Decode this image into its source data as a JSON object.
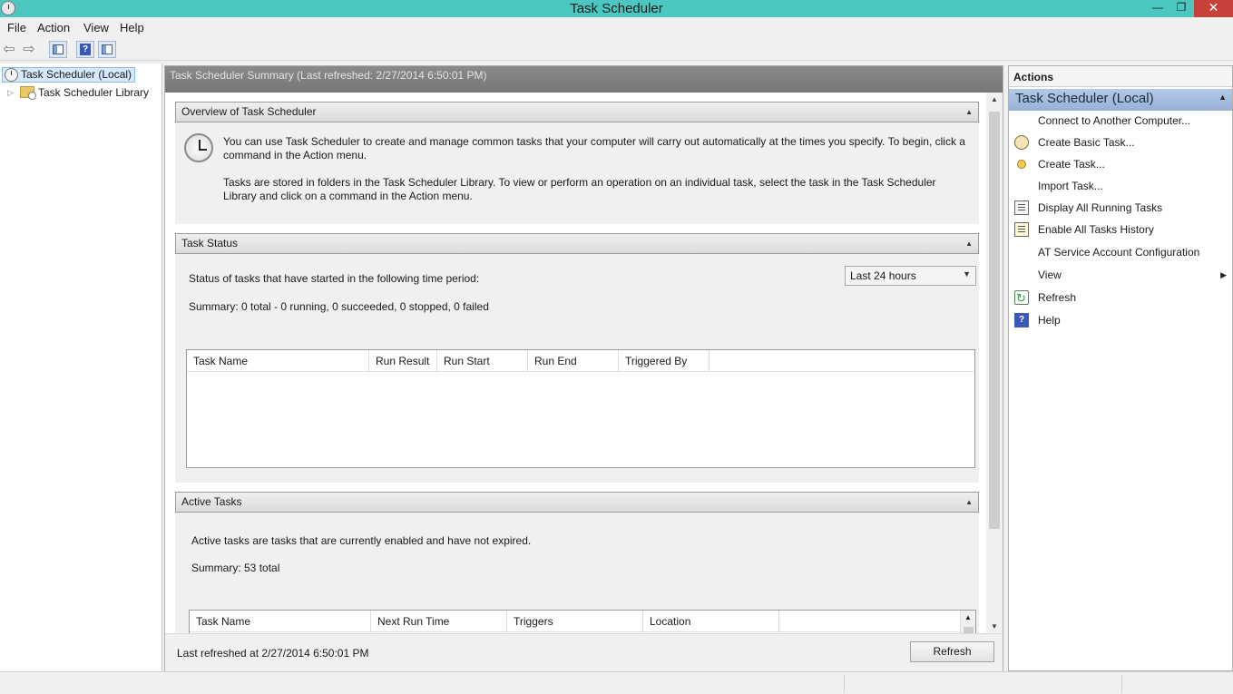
{
  "window": {
    "title": "Task Scheduler",
    "controls": {
      "minimize": "—",
      "maximize": "❐",
      "close": "✕"
    }
  },
  "menu": [
    "File",
    "Action",
    "View",
    "Help"
  ],
  "toolbar": {
    "icons": [
      "back-arrow-icon",
      "forward-arrow-icon",
      "show-hide-console-tree-icon",
      "help-icon",
      "show-hide-action-pane-icon"
    ],
    "help_glyph": "?"
  },
  "tree": {
    "root": "Task Scheduler (Local)",
    "children": [
      "Task Scheduler Library"
    ]
  },
  "center": {
    "header": "Task Scheduler Summary (Last refreshed: 2/27/2014 6:50:01 PM)",
    "overview": {
      "title": "Overview of Task Scheduler",
      "p1": "You can use Task Scheduler to create and manage common tasks that your computer will carry out automatically at the times you specify. To begin, click a command in the Action menu.",
      "p2": "Tasks are stored in folders in the Task Scheduler Library. To view or perform an operation on an individual task, select the task in the Task Scheduler Library and click on a command in the Action menu."
    },
    "status": {
      "title": "Task Status",
      "label": "Status of tasks that have started in the following time period:",
      "period": "Last 24 hours",
      "summary": "Summary: 0 total - 0 running, 0 succeeded, 0 stopped, 0 failed",
      "columns": [
        "Task Name",
        "Run Result",
        "Run Start",
        "Run End",
        "Triggered By"
      ]
    },
    "active": {
      "title": "Active Tasks",
      "desc": "Active tasks are tasks that are currently enabled and have not expired.",
      "summary": "Summary: 53 total",
      "columns": [
        "Task Name",
        "Next Run Time",
        "Triggers",
        "Location"
      ]
    },
    "footer": {
      "last_refreshed": "Last refreshed at 2/27/2014 6:50:01 PM",
      "refresh_label": "Refresh"
    }
  },
  "actions": {
    "title": "Actions",
    "group": "Task Scheduler (Local)",
    "items": [
      "Connect to Another Computer...",
      "Create Basic Task...",
      "Create Task...",
      "Import Task...",
      "Display All Running Tasks",
      "Enable All Tasks History",
      "AT Service Account Configuration",
      "View",
      "Refresh",
      "Help"
    ],
    "help_glyph": "?"
  },
  "glyphs": {
    "back_arrow": "⇦",
    "forward_arrow": "⇨",
    "collapse_up": "▲",
    "expand_right": "▷",
    "caret_down": "▼",
    "submenu_right": "▶"
  }
}
